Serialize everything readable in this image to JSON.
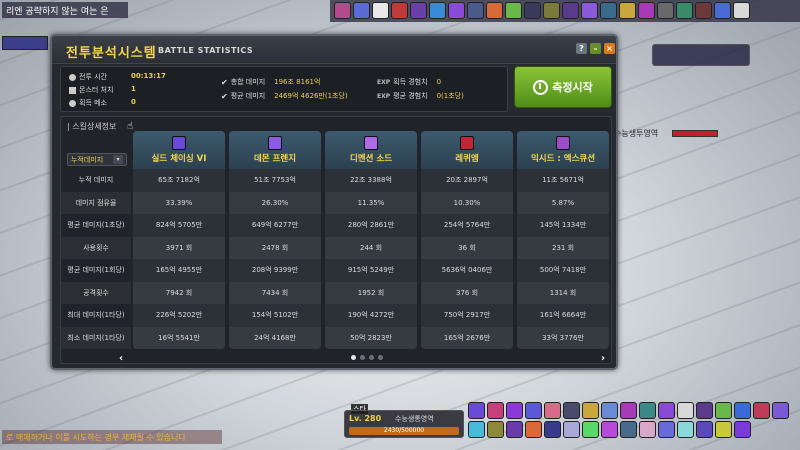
{
  "window": {
    "title": "전투분석시스템",
    "subtitle": "BATTLE STATISTICS",
    "help_label": "?",
    "min_label": "–",
    "close_label": "×"
  },
  "stats": {
    "battle_time_label": "전투 시간",
    "battle_time_value": "00:13:17",
    "monsters_label": "몬스터 처치",
    "monsters_value": "1",
    "meso_label": "획득 메소",
    "meso_value": "0",
    "total_damage_label": "총합 데미지",
    "total_damage_value": "196조 8161억",
    "avg_damage_label": "평균 데미지",
    "avg_damage_value": "2469억 4626만(1초당)",
    "exp_tag": "EXP",
    "exp_label": "획득 경험치",
    "exp_value": "0",
    "avg_exp_label": "평균 경험치",
    "avg_exp_value": "0(1초당)"
  },
  "start_button": {
    "label": "측정시작"
  },
  "table": {
    "section_label": "| 스킬상세정보",
    "dropdown_value": "누적데미지",
    "dropdown_arrow": "▾",
    "row_labels": [
      "누적 데미지",
      "데미지 점유율",
      "평균 데미지(1초당)",
      "사용횟수",
      "평균 데미지(1회당)",
      "공격횟수",
      "최대 데미지(1타당)",
      "최소 데미지(1타당)"
    ],
    "columns": [
      {
        "name": "실드 체이싱 VI",
        "icon_color": "#6a4bd8",
        "values": [
          "65조 7182억",
          "33.39%",
          "824억 5705만",
          "3971 회",
          "165억 4955만",
          "7942 회",
          "226억 5202만",
          "16억 5541만"
        ]
      },
      {
        "name": "데몬 프렌지",
        "icon_color": "#8a5ce0",
        "values": [
          "51조 7753억",
          "26.30%",
          "649억 6277만",
          "2478 회",
          "208억 9399만",
          "7434 회",
          "154억 5102만",
          "24억 4168만"
        ]
      },
      {
        "name": "디멘션 소드",
        "icon_color": "#b06ae8",
        "values": [
          "22조 3388억",
          "11.35%",
          "280억 2861만",
          "244 회",
          "915억 5249만",
          "1952 회",
          "190억 4272만",
          "50억 2823만"
        ]
      },
      {
        "name": "레퀴엠",
        "icon_color": "#c0253a",
        "values": [
          "20조 2897억",
          "10.30%",
          "254억 5764만",
          "36 회",
          "5636억 0406만",
          "376 회",
          "750억 2917만",
          "165억 2676만"
        ]
      },
      {
        "name": "익시드 : 엑스큐션",
        "icon_color": "#9b4dc8",
        "values": [
          "11조 5671억",
          "5.87%",
          "145억 1334만",
          "231 회",
          "500억 7418만",
          "1314 회",
          "161억 6664만",
          "33억 3776만"
        ]
      }
    ],
    "nav_prev": "‹",
    "nav_next": "›"
  },
  "hud": {
    "topleft_title": "리엔 공략하지 않는 여는 은",
    "chat_line": "로 매매하거나 이를 시도하는 경우 제재될 수 있습니다",
    "level": "Lv. 280",
    "job": "수능생통영역",
    "hp_text": "2430/500000",
    "side_label": "수능생투영역",
    "status_tag": "스타"
  },
  "colors": {
    "accent_yellow": "#f5d54a",
    "start_green": "#6aa92a",
    "close_orange": "#d97a1a"
  }
}
